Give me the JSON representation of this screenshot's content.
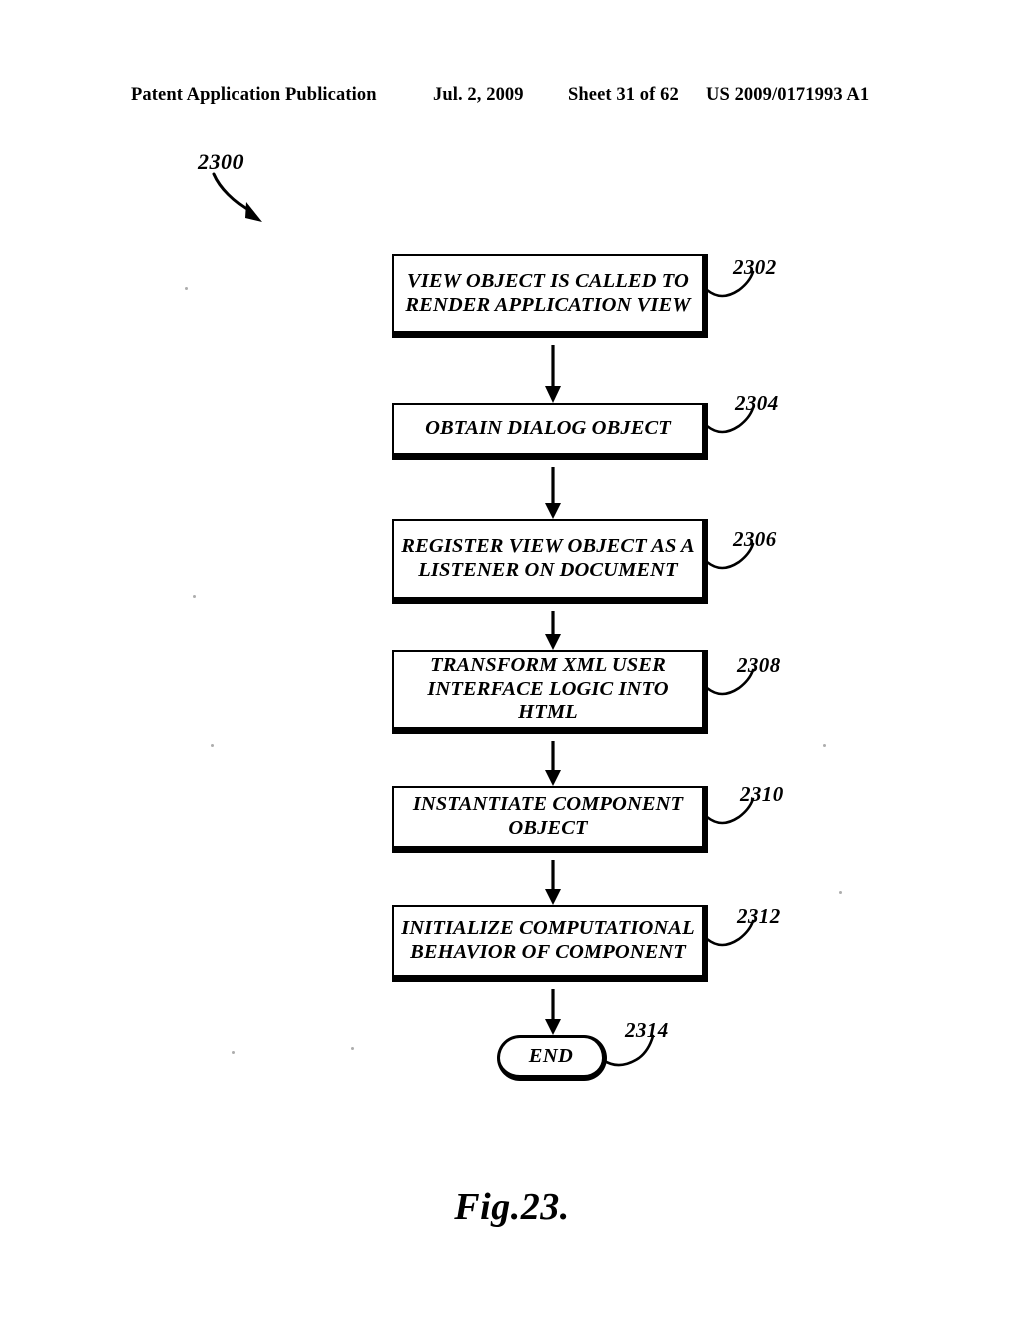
{
  "header": {
    "publication": "Patent Application Publication",
    "date": "Jul. 2, 2009",
    "sheet": "Sheet 31 of 62",
    "patent_number": "US 2009/0171993 A1"
  },
  "figure": {
    "caption": "Fig.23.",
    "diagram_ref": "2300",
    "type": "flowchart",
    "orientation": "top-to-bottom",
    "nodes": [
      {
        "ref": "2302",
        "shape": "process",
        "text": "VIEW OBJECT IS CALLED TO\nRENDER APPLICATION VIEW"
      },
      {
        "ref": "2304",
        "shape": "process",
        "text": "OBTAIN DIALOG OBJECT"
      },
      {
        "ref": "2306",
        "shape": "process",
        "text": "REGISTER VIEW OBJECT AS A\nLISTENER ON DOCUMENT"
      },
      {
        "ref": "2308",
        "shape": "process",
        "text": "TRANSFORM XML USER\nINTERFACE LOGIC INTO\nHTML"
      },
      {
        "ref": "2310",
        "shape": "process",
        "text": "INSTANTIATE COMPONENT\nOBJECT"
      },
      {
        "ref": "2312",
        "shape": "process",
        "text": "INITIALIZE COMPUTATIONAL\nBEHAVIOR OF COMPONENT"
      },
      {
        "ref": "2314",
        "shape": "terminator",
        "text": "END"
      }
    ]
  },
  "colors": {
    "ink": "#000000",
    "paper": "#ffffff"
  }
}
